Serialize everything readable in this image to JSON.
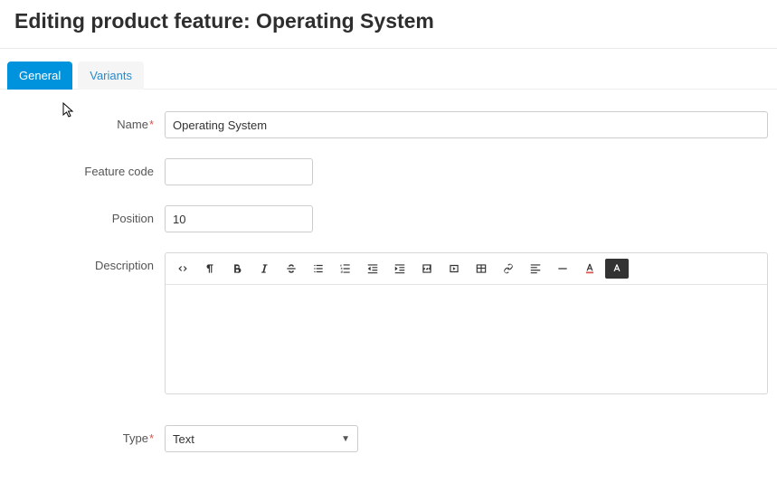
{
  "header": {
    "title": "Editing product feature: Operating System"
  },
  "tabs": [
    {
      "label": "General",
      "active": true
    },
    {
      "label": "Variants",
      "active": false
    }
  ],
  "form": {
    "name_label": "Name",
    "name_value": "Operating System",
    "feature_code_label": "Feature code",
    "feature_code_value": "",
    "position_label": "Position",
    "position_value": "10",
    "description_label": "Description",
    "type_label": "Type",
    "type_value": "Text"
  },
  "editor_icons": [
    "code-view-icon",
    "paragraph-icon",
    "bold-icon",
    "italic-icon",
    "strike-icon",
    "ul-icon",
    "ol-icon",
    "outdent-icon",
    "indent-icon",
    "image-icon",
    "video-icon",
    "table-icon",
    "link-icon",
    "align-icon",
    "hr-icon",
    "text-color-icon",
    "bg-color-icon"
  ]
}
